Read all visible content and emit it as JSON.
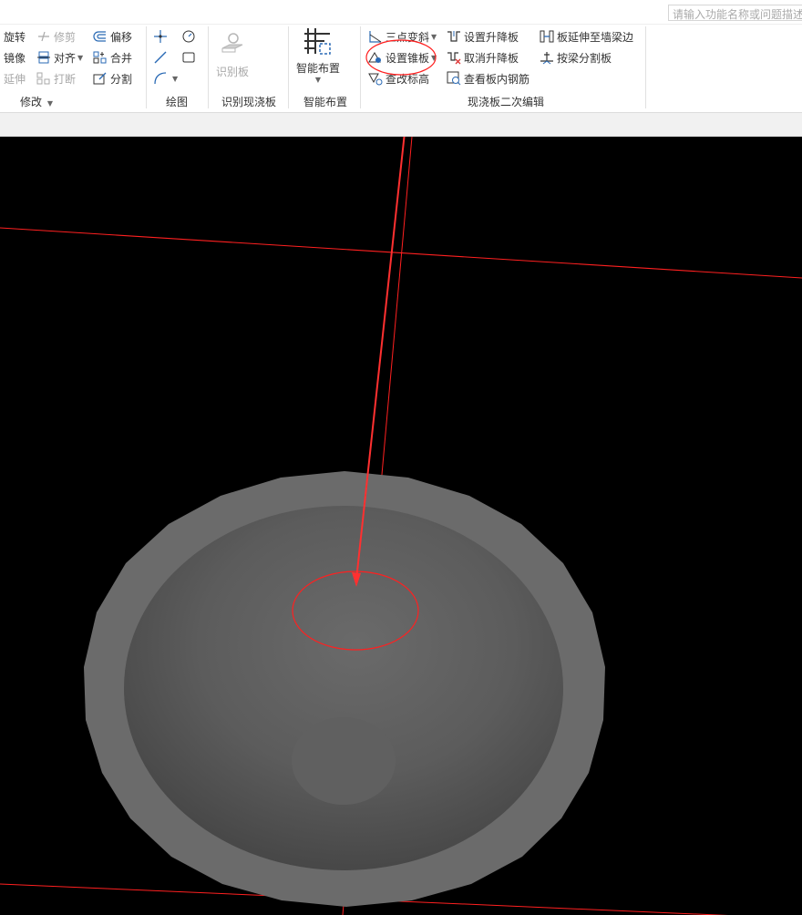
{
  "search": {
    "placeholder": "请输入功能名称或问题描述"
  },
  "ribbon": {
    "modify": {
      "group_label": "修改",
      "rotate": "旋转",
      "trim": "修剪",
      "offset": "偏移",
      "mirror": "镜像",
      "align": "对齐",
      "merge": "合并",
      "extend": "延伸",
      "break": "打断",
      "split": "分割"
    },
    "draw": {
      "group_label": "绘图"
    },
    "recognize": {
      "group_label": "识别现浇板",
      "button": "识别板"
    },
    "smart": {
      "group_label": "智能布置",
      "button": "智能布置"
    },
    "slab_edit": {
      "group_label": "现浇板二次编辑",
      "two_point_slope": "三点变斜",
      "set_raise_slab": "设置升降板",
      "extend_to_edge": "板延伸至墙梁边",
      "set_cone_slab": "设置锥板",
      "cancel_raise_slab": "取消升降板",
      "split_by_beam": "按梁分割板",
      "check_elevation": "查改标高",
      "view_rebar": "查看板内钢筋"
    }
  },
  "colors": {
    "viewport_bg": "#000000",
    "annotation": "#ff2020",
    "slab_outer": "#6b6b6b",
    "slab_inner": "#585858",
    "ribbon_bg": "#ffffff",
    "status_bar": "#f1f1f1"
  }
}
